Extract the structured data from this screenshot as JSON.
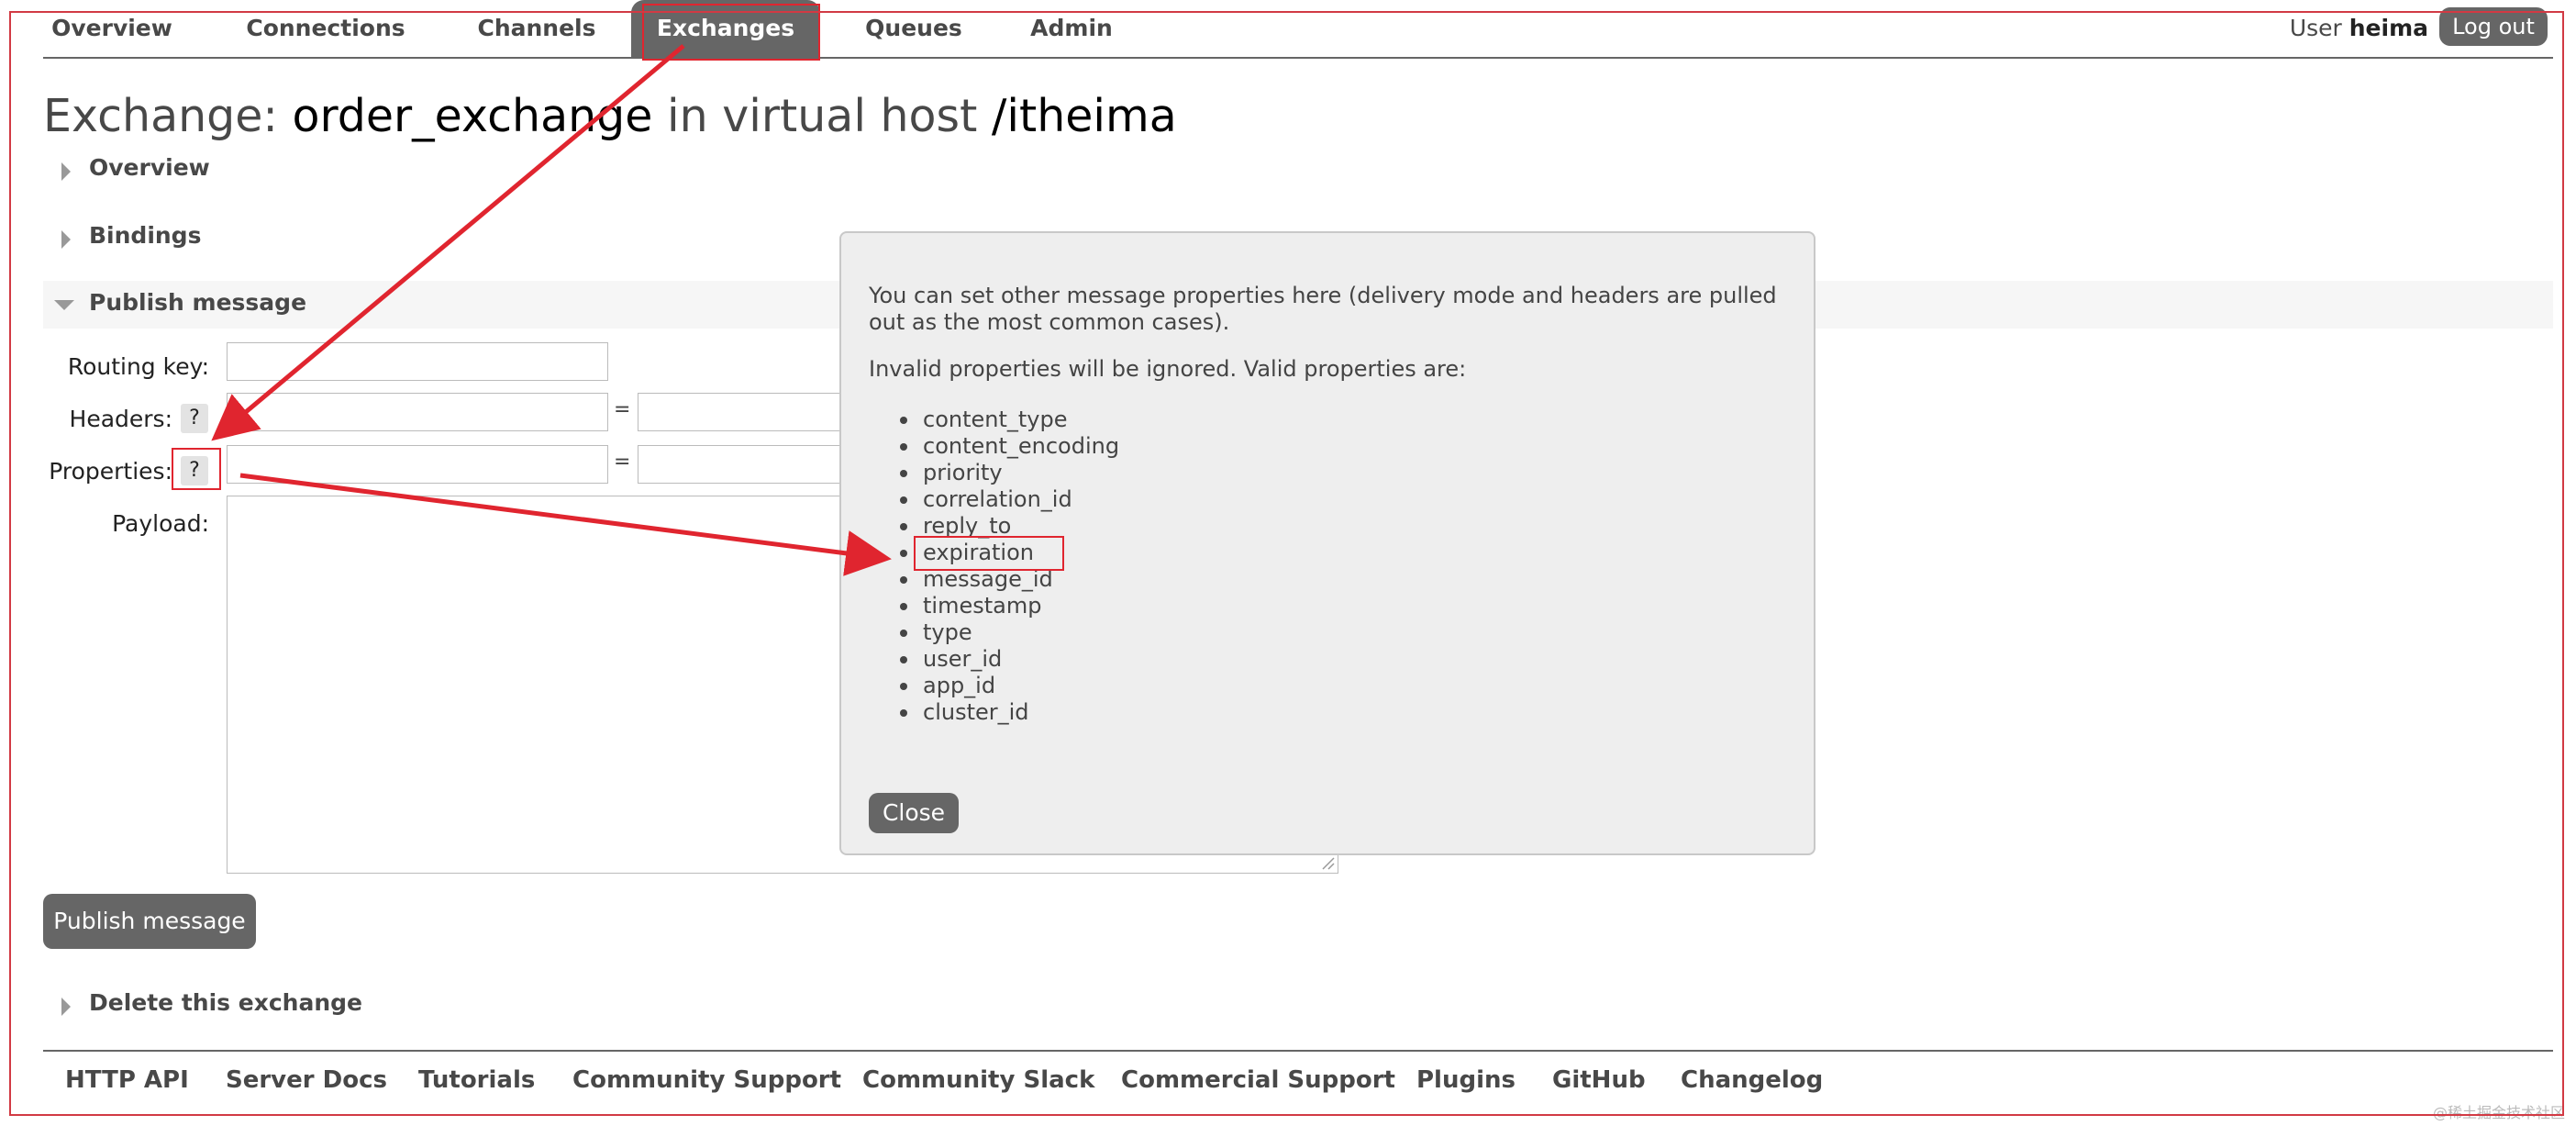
{
  "nav": {
    "tabs": [
      {
        "label": "Overview",
        "active": false
      },
      {
        "label": "Connections",
        "active": false
      },
      {
        "label": "Channels",
        "active": false
      },
      {
        "label": "Exchanges",
        "active": true
      },
      {
        "label": "Queues",
        "active": false
      },
      {
        "label": "Admin",
        "active": false
      }
    ],
    "user_prefix": "User",
    "user_name": "heima",
    "logout_label": "Log out"
  },
  "page": {
    "title_prefix": "Exchange:",
    "exchange_name": "order_exchange",
    "title_mid": "in virtual host",
    "vhost": "/itheima"
  },
  "sections": {
    "overview": "Overview",
    "bindings": "Bindings",
    "publish": "Publish message",
    "delete": "Delete this exchange"
  },
  "form": {
    "routing_key_label": "Routing key:",
    "headers_label": "Headers:",
    "properties_label": "Properties:",
    "payload_label": "Payload:",
    "help_label": "?",
    "equals": "=",
    "publish_button": "Publish message"
  },
  "popup": {
    "intro": "You can set other message properties here (delivery mode and headers are pulled out as the most common cases).",
    "invalid_note": "Invalid properties will be ignored. Valid properties are:",
    "properties": [
      "content_type",
      "content_encoding",
      "priority",
      "correlation_id",
      "reply_to",
      "expiration",
      "message_id",
      "timestamp",
      "type",
      "user_id",
      "app_id",
      "cluster_id"
    ],
    "close_label": "Close"
  },
  "footer": {
    "links": [
      "HTTP API",
      "Server Docs",
      "Tutorials",
      "Community Support",
      "Community Slack",
      "Commercial Support",
      "Plugins",
      "GitHub",
      "Changelog"
    ]
  },
  "watermark": "@稀土掘金技术社区",
  "colors": {
    "nav_active_bg": "#666666",
    "annotation_red": "#e0252f",
    "popup_bg": "#eeeeee"
  }
}
